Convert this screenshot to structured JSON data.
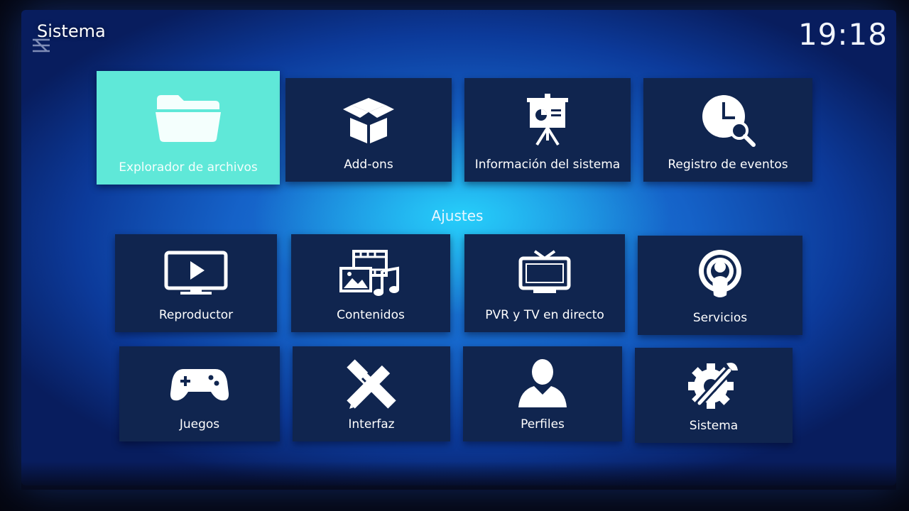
{
  "header": {
    "title": "Sistema",
    "clock": "19:18"
  },
  "section": {
    "settings_label": "Ajustes"
  },
  "top_row": [
    {
      "label": "Explorador de archivos",
      "icon": "folder-icon",
      "focused": true
    },
    {
      "label": "Add-ons",
      "icon": "box-icon"
    },
    {
      "label": "Información del sistema",
      "icon": "presentation-board-icon"
    },
    {
      "label": "Registro de eventos",
      "icon": "clock-search-icon"
    }
  ],
  "settings_row1": [
    {
      "label": "Reproductor",
      "icon": "tv-play-icon"
    },
    {
      "label": "Contenidos",
      "icon": "media-library-icon"
    },
    {
      "label": "PVR y TV en directo",
      "icon": "tv-antenna-icon"
    },
    {
      "label": "Servicios",
      "icon": "podcast-icon"
    }
  ],
  "settings_row2": [
    {
      "label": "Juegos",
      "icon": "gamepad-icon"
    },
    {
      "label": "Interfaz",
      "icon": "pencil-ruler-icon"
    },
    {
      "label": "Perfiles",
      "icon": "user-profile-icon"
    },
    {
      "label": "Sistema",
      "icon": "gear-wrench-icon"
    }
  ],
  "colors": {
    "focus": "#5fe8d8",
    "tile": "#10254f",
    "background": "#1562c8"
  }
}
